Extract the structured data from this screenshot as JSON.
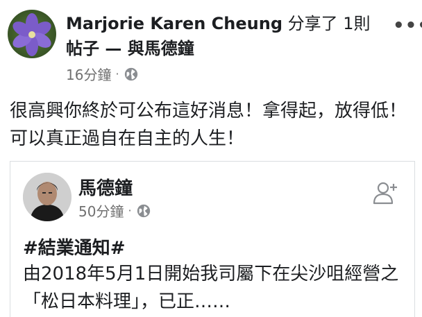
{
  "post": {
    "poster_name": "Marjorie Karen Cheung",
    "shared_text": " 分享了 1則",
    "line2_prefix": "帖子 — 與",
    "tagged_name": "馬德鐘",
    "time": "16分鐘",
    "dot": "·",
    "more": "•••",
    "body": "很高興你終於可公布這好消息！拿得起，放得低！可以真正過自在自主的人生！"
  },
  "shared_post": {
    "author": "馬德鐘",
    "time": "50分鐘",
    "dot": "·",
    "headline": "#結業通知#",
    "body": "由2018年5月1日開始我司屬下在尖沙咀經營之「松日本料理」，已正……"
  },
  "icons": {
    "more": "more-options-icon",
    "globe": "public-globe-icon",
    "add_friend": "add-friend-icon"
  },
  "colors": {
    "text": "#1c1e21",
    "meta": "#707070",
    "border": "#dadde1"
  }
}
